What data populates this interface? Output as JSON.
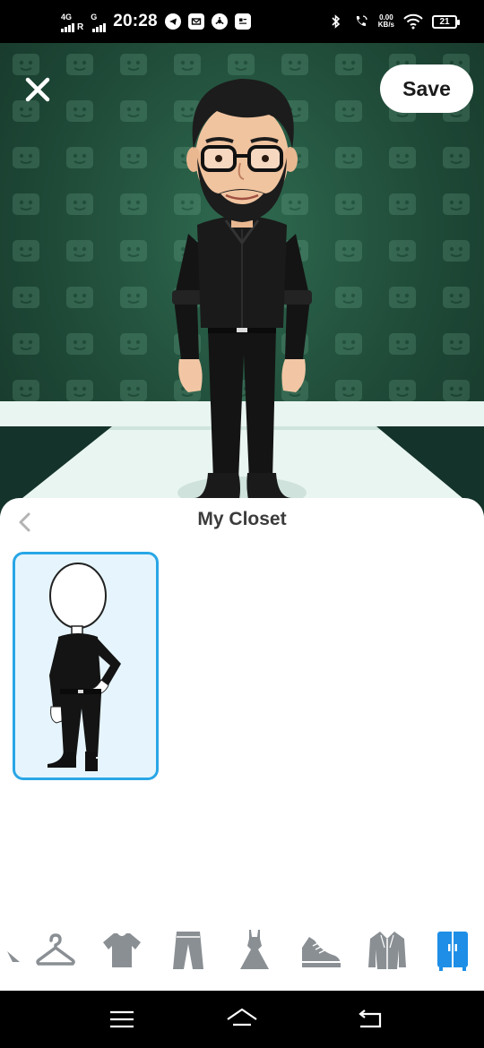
{
  "status_bar": {
    "network1": "4G",
    "network1_suffix": "R",
    "network2": "G",
    "time": "20:28",
    "speed_value": "0.00",
    "speed_unit": "KB/s",
    "battery": "21"
  },
  "header": {
    "save_label": "Save",
    "close_icon": "close-icon"
  },
  "closet": {
    "title": "My Closet",
    "back_icon": "chevron-left-icon",
    "selected_color": "#29a6e6"
  },
  "categories": [
    {
      "name": "hanger",
      "icon": "hanger-icon",
      "active": false
    },
    {
      "name": "tops",
      "icon": "tshirt-icon",
      "active": false
    },
    {
      "name": "bottoms",
      "icon": "pants-icon",
      "active": false
    },
    {
      "name": "dresses",
      "icon": "dress-icon",
      "active": false
    },
    {
      "name": "shoes",
      "icon": "sneaker-icon",
      "active": false
    },
    {
      "name": "outerwear",
      "icon": "jacket-icon",
      "active": false
    },
    {
      "name": "closet",
      "icon": "wardrobe-icon",
      "active": true
    }
  ],
  "colors": {
    "accent": "#1e8ee6",
    "inactive_icon": "#8a8f94",
    "stage_green": "#24513f"
  },
  "nav": {
    "menu_icon": "menu-icon",
    "home_icon": "home-icon",
    "back_icon": "back-icon"
  }
}
